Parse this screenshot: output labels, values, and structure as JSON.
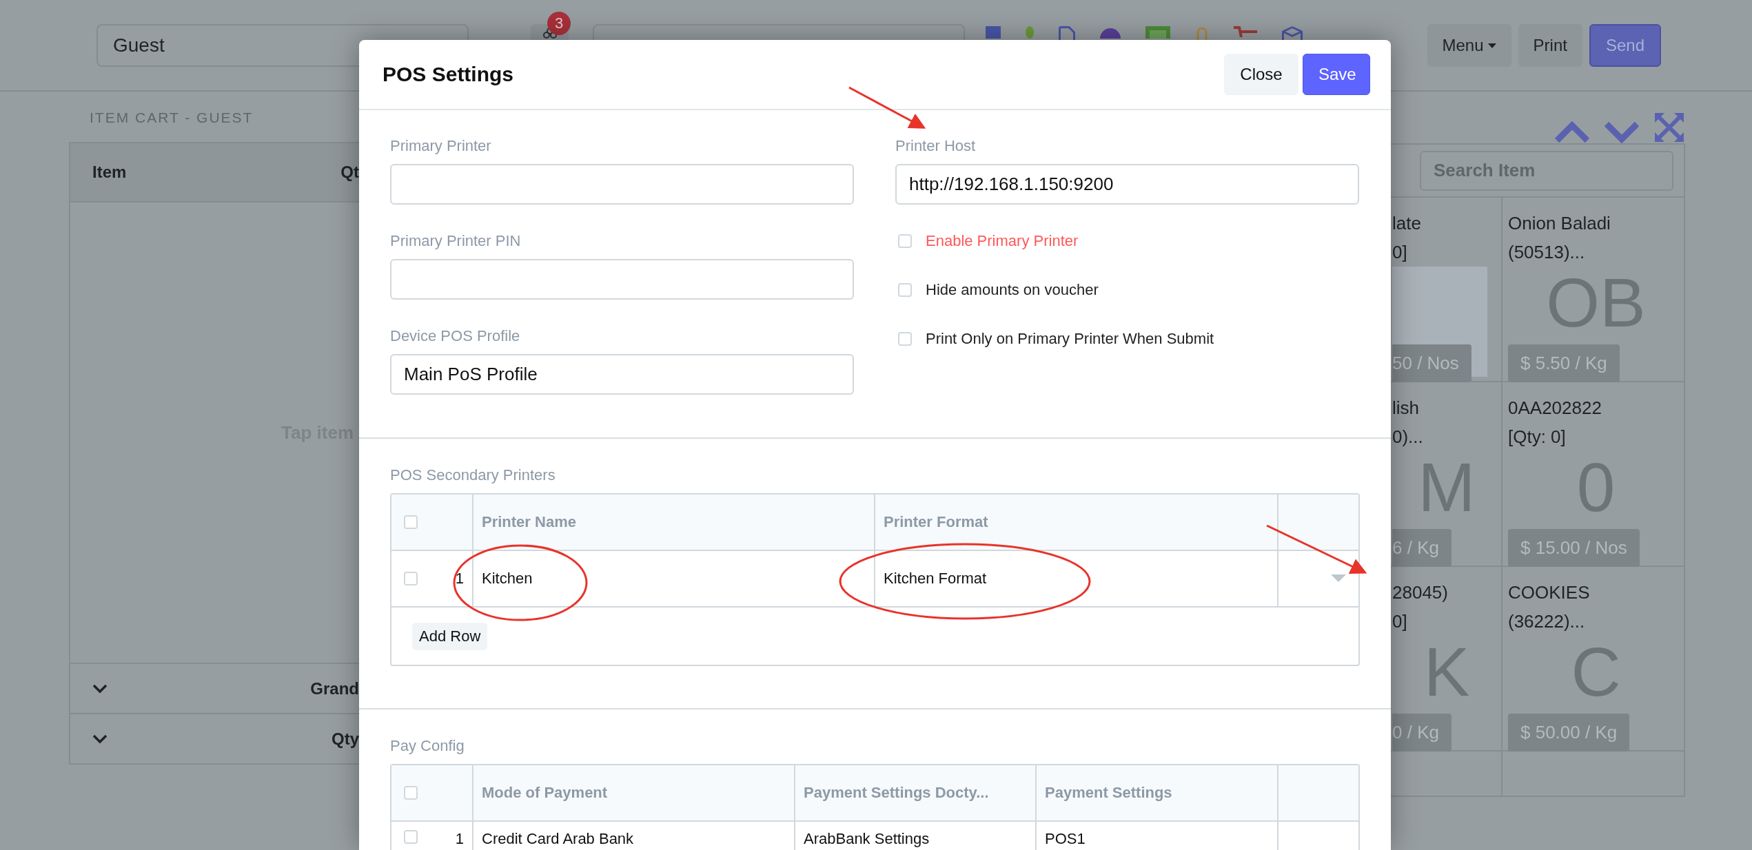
{
  "top_bar": {
    "customer": "Guest",
    "notification_count": "3",
    "buttons": [
      {
        "label": "Menu",
        "kind": "dropdown"
      },
      {
        "label": "Print",
        "kind": "plain"
      },
      {
        "label": "Send",
        "kind": "primary"
      }
    ]
  },
  "cart": {
    "title": "ITEM CART - GUEST",
    "columns": [
      "Item",
      "Qt"
    ],
    "empty_hint": "Tap item",
    "totals": [
      "Grand",
      "Qty"
    ]
  },
  "items": {
    "search": {
      "placeholder": "Search Item"
    },
    "cells": [
      {
        "line_1": "late",
        "line_2": "0]",
        "kind": "photo",
        "price": "50 / Nos"
      },
      {
        "line_1": "Onion Baladi",
        "line_2": "(50513)...",
        "kind": "letter",
        "letter": "OB",
        "price": "$ 5.50 / Kg"
      },
      {
        "line_1": "lish",
        "line_2": "0)...",
        "kind": "letter",
        "letter": "M",
        "price": "6 / Kg"
      },
      {
        "line_1": "0AA202822",
        "line_2": "[Qty: 0]",
        "kind": "letter",
        "letter": "0",
        "price": "$ 15.00 / Nos"
      },
      {
        "line_1": "28045)",
        "line_2": "0]",
        "kind": "letter",
        "letter": "K",
        "price": "0 / Kg"
      },
      {
        "line_1": "COOKIES",
        "line_2": "(36222)...",
        "kind": "letter",
        "letter": "C",
        "price": "$ 50.00 / Kg"
      }
    ]
  },
  "modal": {
    "title": "POS Settings",
    "buttons": [
      {
        "label": "Close",
        "kind": "secondary"
      },
      {
        "label": "Save",
        "kind": "primary"
      }
    ],
    "left_fields": [
      {
        "label": "Primary Printer"
      },
      {
        "label": "Primary Printer PIN"
      },
      {
        "label": "Device POS Profile",
        "value": "Main PoS Profile"
      }
    ],
    "right_field": {
      "label": "Printer Host",
      "value": "http://192.168.1.150:9200"
    },
    "options": [
      {
        "label": "Enable Primary Printer",
        "checked": false,
        "highlighted": true
      },
      {
        "label": "Hide amounts on voucher",
        "checked": false,
        "highlighted": false
      },
      {
        "label": "Print Only on Primary Printer When Submit",
        "checked": false,
        "highlighted": false
      }
    ],
    "secondary_printers": {
      "title": "POS Secondary Printers",
      "all_checked": false,
      "columns": [
        "Printer Name",
        "Printer Format"
      ],
      "rows": [
        {
          "index": "1",
          "checked": false,
          "cells": [
            "Kitchen",
            "Kitchen Format"
          ]
        }
      ],
      "add_button": "Add Row"
    },
    "pay_config": {
      "title": "Pay Config",
      "all_checked": false,
      "columns": [
        "Mode of Payment",
        "Payment Settings Docty...",
        "Payment Settings"
      ],
      "rows": [
        {
          "index": "1",
          "checked": false,
          "cells": [
            "Credit Card Arab Bank",
            "ArabBank Settings",
            "POS1"
          ]
        }
      ]
    }
  }
}
